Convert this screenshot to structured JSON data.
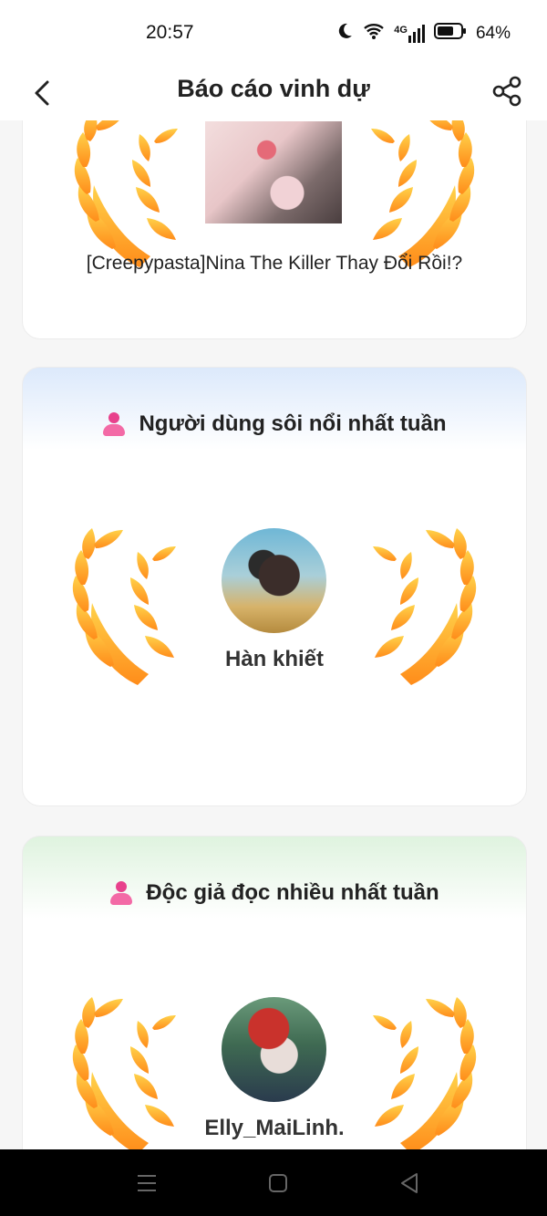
{
  "status": {
    "time": "20:57",
    "network": "4G",
    "battery": "64%"
  },
  "header": {
    "title": "Báo cáo vinh dự"
  },
  "story_card": {
    "story_title": "[Creepypasta]Nina The Killer Thay Đổi Rồi!?"
  },
  "active_user_card": {
    "title": "Người dùng sôi nổi nhất tuần",
    "user_name": "Hàn khiết"
  },
  "reader_card": {
    "title": "Độc giả đọc nhiều nhất tuần",
    "user_name": "Elly_MaiLinh."
  },
  "colors": {
    "laurel_light": "#ffd24a",
    "laurel_dark": "#ff8c1a",
    "accent_pink": "#e8418c"
  }
}
